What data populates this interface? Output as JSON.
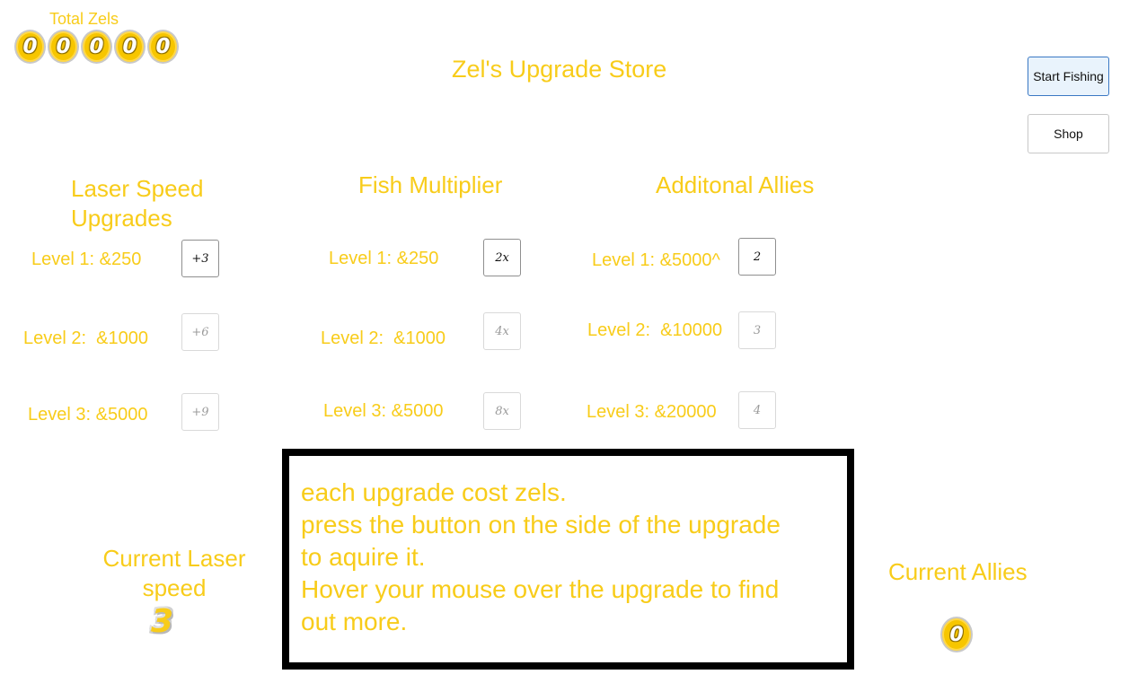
{
  "total": {
    "label": "Total Zels",
    "digits": [
      "0",
      "0",
      "0",
      "0",
      "0"
    ]
  },
  "store": {
    "title": "Zel's Upgrade Store"
  },
  "nav": {
    "start_fishing": "Start Fishing",
    "shop": "Shop"
  },
  "columns": {
    "laser": {
      "title_line1": "Laser Speed",
      "title_line2": "Upgrades",
      "levels": [
        {
          "label": "Level 1: &250",
          "button": "+3"
        },
        {
          "label": "Level 2:  &1000",
          "button": "+6"
        },
        {
          "label": "Level 3: &5000",
          "button": "+9"
        }
      ]
    },
    "fish": {
      "title": "Fish Multiplier",
      "levels": [
        {
          "label": "Level 1: &250",
          "button": "2x"
        },
        {
          "label": "Level 2:  &1000",
          "button": "4x"
        },
        {
          "label": "Level 3: &5000",
          "button": "8x"
        }
      ]
    },
    "allies": {
      "title": "Additonal Allies",
      "levels": [
        {
          "label": "Level 1: &5000^",
          "button": "2"
        },
        {
          "label": "Level 2:  &10000",
          "button": "3"
        },
        {
          "label": "Level 3: &20000",
          "button": "4"
        }
      ]
    }
  },
  "info": {
    "line1": "each upgrade cost zels.",
    "line2": "press the button on the side of the upgrade",
    "line3": "to aquire it.",
    "line4": "Hover your mouse over the upgrade to find",
    "line5": "out more."
  },
  "current": {
    "laser_label_line1": "Current Laser",
    "laser_label_line2": "speed",
    "laser_value": "3",
    "allies_label": "Current Allies",
    "allies_value": "0"
  },
  "colors": {
    "accent_gold": "#f8cc1a",
    "coin_fill": "#f7c600",
    "primary_button_bg": "#e9f3fc",
    "primary_button_border": "#3a78c4"
  }
}
